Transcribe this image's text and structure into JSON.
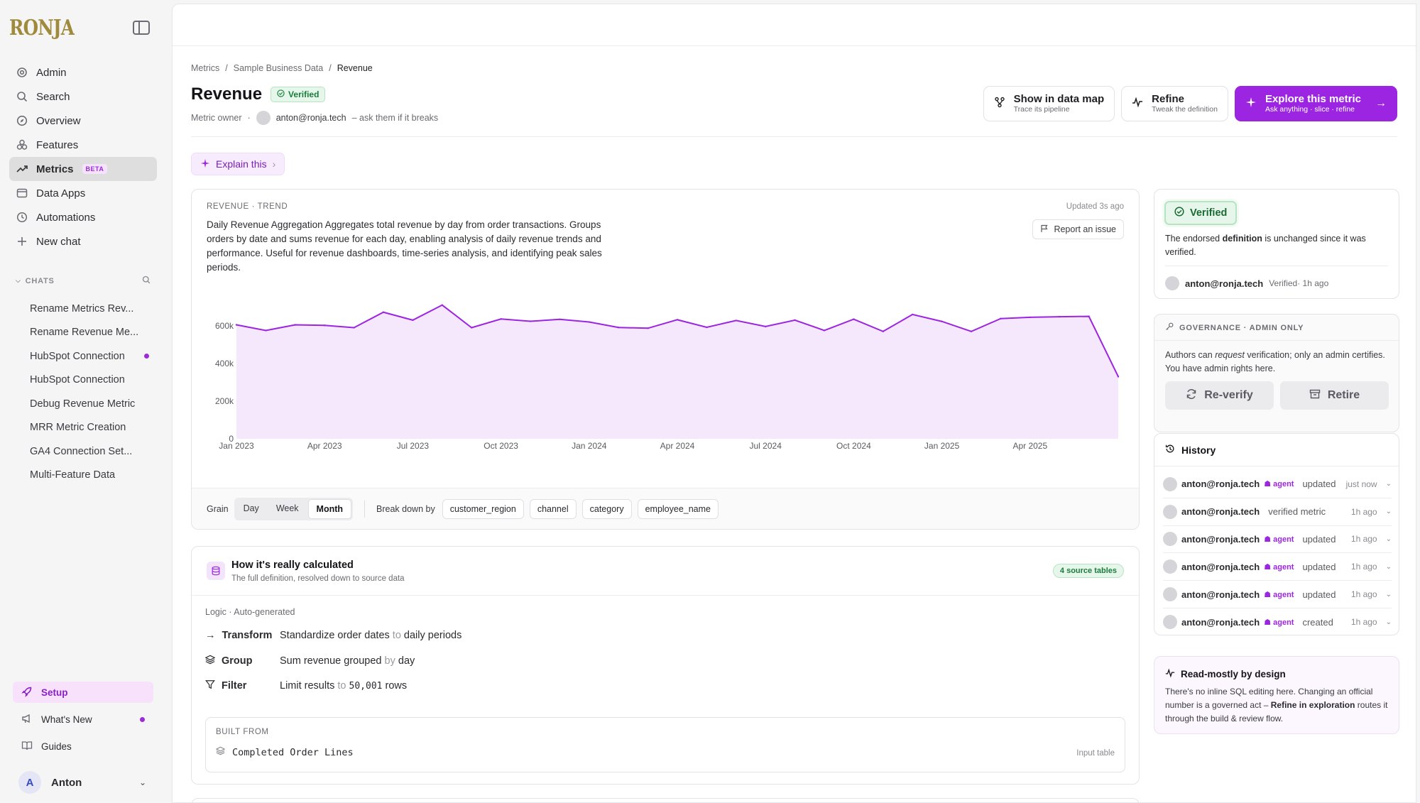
{
  "app": {
    "logo": "RONJA"
  },
  "sidebar": {
    "nav": [
      {
        "label": "Admin",
        "icon": "gear-icon"
      },
      {
        "label": "Search",
        "icon": "search-icon"
      },
      {
        "label": "Overview",
        "icon": "compass-icon"
      },
      {
        "label": "Features",
        "icon": "features-icon"
      },
      {
        "label": "Metrics",
        "icon": "trend-icon",
        "badge": "BETA",
        "active": true
      },
      {
        "label": "Data Apps",
        "icon": "app-window-icon"
      },
      {
        "label": "Automations",
        "icon": "clock-icon"
      },
      {
        "label": "New chat",
        "icon": "plus-icon"
      }
    ],
    "chats_label": "CHATS",
    "chats": [
      {
        "label": "Rename Metrics Rev..."
      },
      {
        "label": "Rename Revenue Me..."
      },
      {
        "label": "HubSpot Connection",
        "unread": true
      },
      {
        "label": "HubSpot Connection"
      },
      {
        "label": "Debug Revenue Metric"
      },
      {
        "label": "MRR Metric Creation"
      },
      {
        "label": "GA4 Connection Set..."
      },
      {
        "label": "Multi-Feature Data"
      }
    ],
    "bottom": [
      {
        "label": "Setup",
        "icon": "rocket-icon"
      },
      {
        "label": "What's New",
        "icon": "megaphone-icon",
        "unread": true
      },
      {
        "label": "Guides",
        "icon": "book-icon"
      }
    ],
    "user": {
      "initial": "A",
      "name": "Anton"
    }
  },
  "header": {
    "breadcrumb": [
      "Metrics",
      "Sample Business Data",
      "Revenue"
    ],
    "title": "Revenue",
    "verified": "Verified",
    "owner_label": "Metric owner",
    "owner_email": "anton@ronja.tech",
    "owner_note": "– ask them if it breaks",
    "actions": [
      {
        "title": "Show in data map",
        "subtitle": "Trace its pipeline",
        "icon": "data-map-icon"
      },
      {
        "title": "Refine",
        "subtitle": "Tweak the definition",
        "icon": "pulse-icon"
      },
      {
        "title": "Explore this metric",
        "subtitle": "Ask anything · slice · refine",
        "icon": "sparkle-icon",
        "primary": true
      }
    ],
    "explain": "Explain this"
  },
  "trend": {
    "label": "REVENUE · TREND",
    "updated": "Updated 3s ago",
    "description": "Daily Revenue Aggregation Aggregates total revenue by day from order transactions. Groups orders by date and sums revenue for each day, enabling analysis of daily revenue trends and performance. Useful for revenue dashboards, time-series analysis, and identifying peak sales periods.",
    "report": "Report an issue",
    "grain_label": "Grain",
    "grains": [
      "Day",
      "Week",
      "Month"
    ],
    "grain_selected": "Month",
    "breakdown_label": "Break down by",
    "breakdowns": [
      "customer_region",
      "channel",
      "category",
      "employee_name"
    ]
  },
  "chart_data": {
    "type": "area",
    "color": "#9b25e0",
    "fill": "#f5e7fc",
    "x_ticks": [
      "Jan 2023",
      "Apr 2023",
      "Jul 2023",
      "Oct 2023",
      "Jan 2024",
      "Apr 2024",
      "Jul 2024",
      "Oct 2024",
      "Jan 2025",
      "Apr 2025"
    ],
    "y_ticks": [
      "0",
      "200k",
      "400k",
      "600k"
    ],
    "ylim": [
      0,
      720000
    ],
    "x": [
      "2023-01",
      "2023-02",
      "2023-03",
      "2023-04",
      "2023-05",
      "2023-06",
      "2023-07",
      "2023-08",
      "2023-09",
      "2023-10",
      "2023-11",
      "2023-12",
      "2024-01",
      "2024-02",
      "2024-03",
      "2024-04",
      "2024-05",
      "2024-06",
      "2024-07",
      "2024-08",
      "2024-09",
      "2024-10",
      "2024-11",
      "2024-12",
      "2025-01",
      "2025-02",
      "2025-03",
      "2025-04",
      "2025-05",
      "2025-06",
      "2025-07"
    ],
    "values": [
      605000,
      575000,
      605000,
      602000,
      590000,
      672000,
      630000,
      710000,
      590000,
      636000,
      624000,
      634000,
      620000,
      591000,
      587000,
      632000,
      592000,
      628000,
      596000,
      630000,
      575000,
      635000,
      570000,
      660000,
      623000,
      570000,
      638000,
      645000,
      648000,
      650000,
      330000
    ]
  },
  "calc": {
    "title": "How it's really calculated",
    "subtitle": "The full definition, resolved down to source data",
    "badge": "4 source tables",
    "logic_label": "Logic · Auto-generated",
    "steps": [
      {
        "key": "Transform",
        "icon": "arrow-right-icon",
        "text": "Standardize order dates",
        "conn": "to",
        "tail": "daily periods"
      },
      {
        "key": "Group",
        "icon": "layers-icon",
        "text": "Sum revenue grouped",
        "conn": "by",
        "tail": "day"
      },
      {
        "key": "Filter",
        "icon": "filter-icon",
        "text": "Limit results",
        "conn": "to",
        "code": "50,001",
        "tail": "rows"
      }
    ],
    "built_label": "BUILT FROM",
    "built_name": "Completed Order Lines",
    "built_type": "Input table"
  },
  "verified_card": {
    "badge": "Verified",
    "text_pre": "The endorsed ",
    "text_bold": "definition",
    "text_post": " is unchanged since it was verified.",
    "who": "anton@ronja.tech",
    "meta": "Verified· 1h ago"
  },
  "governance": {
    "label": "GOVERNANCE · ADMIN ONLY",
    "text_pre": "Authors can ",
    "text_em": "request",
    "text_post": " verification; only an admin certifies. You have admin rights here.",
    "reverify": "Re-verify",
    "retire": "Retire"
  },
  "history": {
    "title": "History",
    "rows": [
      {
        "who": "anton@ronja.tech",
        "agent": "agent",
        "action": "updated",
        "time": "just now"
      },
      {
        "who": "anton@ronja.tech",
        "agent": "",
        "action": "verified metric",
        "time": "1h ago"
      },
      {
        "who": "anton@ronja.tech",
        "agent": "agent",
        "action": "updated",
        "time": "1h ago"
      },
      {
        "who": "anton@ronja.tech",
        "agent": "agent",
        "action": "updated",
        "time": "1h ago"
      },
      {
        "who": "anton@ronja.tech",
        "agent": "agent",
        "action": "updated",
        "time": "1h ago"
      },
      {
        "who": "anton@ronja.tech",
        "agent": "agent",
        "action": "created",
        "time": "1h ago"
      }
    ]
  },
  "readmostly": {
    "title": "Read-mostly by design",
    "text_pre": "There's no inline SQL editing here. Changing an official number is a governed act – ",
    "text_bold": "Refine in exploration",
    "text_post": " routes it through the build & review flow."
  }
}
